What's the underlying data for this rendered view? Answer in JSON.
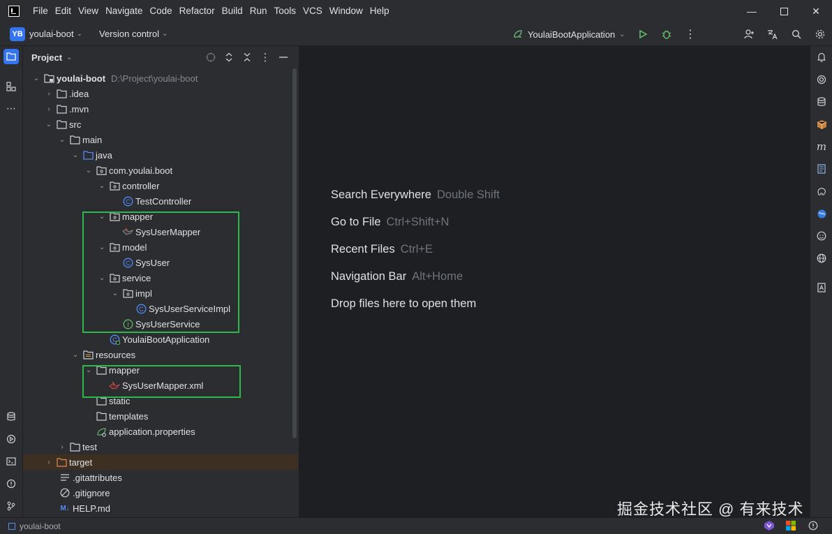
{
  "menubar": {
    "items": [
      "File",
      "Edit",
      "View",
      "Navigate",
      "Code",
      "Refactor",
      "Build",
      "Run",
      "Tools",
      "VCS",
      "Window",
      "Help"
    ]
  },
  "toolbar": {
    "project_badge": "YB",
    "project_name": "youlai-boot",
    "version_control": "Version control",
    "run_config": "YoulaiBootApplication"
  },
  "project_panel": {
    "title": "Project",
    "tree": [
      {
        "label": "youlai-boot",
        "hint": "D:\\Project\\youlai-boot"
      },
      {
        "label": ".idea"
      },
      {
        "label": ".mvn"
      },
      {
        "label": "src"
      },
      {
        "label": "main"
      },
      {
        "label": "java"
      },
      {
        "label": "com.youlai.boot"
      },
      {
        "label": "controller"
      },
      {
        "label": "TestController"
      },
      {
        "label": "mapper"
      },
      {
        "label": "SysUserMapper"
      },
      {
        "label": "model"
      },
      {
        "label": "SysUser"
      },
      {
        "label": "service"
      },
      {
        "label": "impl"
      },
      {
        "label": "SysUserServiceImpl"
      },
      {
        "label": "SysUserService"
      },
      {
        "label": "YoulaiBootApplication"
      },
      {
        "label": "resources"
      },
      {
        "label": "mapper"
      },
      {
        "label": "SysUserMapper.xml"
      },
      {
        "label": "static"
      },
      {
        "label": "templates"
      },
      {
        "label": "application.properties"
      },
      {
        "label": "test"
      },
      {
        "label": "target"
      },
      {
        "label": ".gitattributes"
      },
      {
        "label": ".gitignore"
      },
      {
        "label": "HELP.md"
      }
    ]
  },
  "editor": {
    "hints": [
      {
        "action": "Search Everywhere",
        "shortcut": "Double Shift"
      },
      {
        "action": "Go to File",
        "shortcut": "Ctrl+Shift+N"
      },
      {
        "action": "Recent Files",
        "shortcut": "Ctrl+E"
      },
      {
        "action": "Navigation Bar",
        "shortcut": "Alt+Home"
      },
      {
        "action": "Drop files here to open them",
        "shortcut": ""
      }
    ]
  },
  "statusbar": {
    "project": "youlai-boot"
  },
  "watermark": "掘金技术社区 @ 有来技术",
  "colors": {
    "accent": "#3574f0",
    "highlight_box": "#2fb84a",
    "selected_row": "#3d3023",
    "panel_bg": "#2b2d30",
    "editor_bg": "#1e1f22"
  }
}
